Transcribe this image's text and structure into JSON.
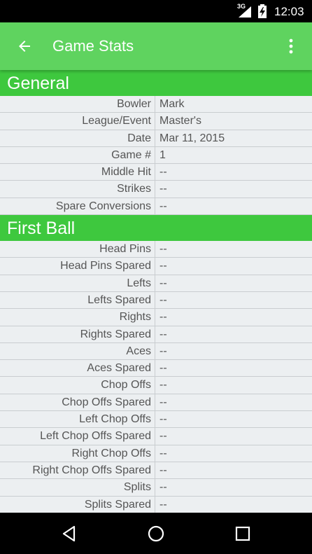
{
  "status_bar": {
    "network": "3G",
    "time": "12:03"
  },
  "app_bar": {
    "title": "Game Stats",
    "back_icon": "arrow-back-icon",
    "menu_icon": "more-vert-icon"
  },
  "colors": {
    "app_bar": "#5FD35F",
    "section_header": "#3EC83E",
    "background": "#ECEFF1"
  },
  "sections": [
    {
      "title": "General",
      "rows": [
        {
          "label": "Bowler",
          "value": "Mark"
        },
        {
          "label": "League/Event",
          "value": "Master's"
        },
        {
          "label": "Date",
          "value": "Mar 11, 2015"
        },
        {
          "label": "Game #",
          "value": "1"
        },
        {
          "label": "Middle Hit",
          "value": "--"
        },
        {
          "label": "Strikes",
          "value": "--"
        },
        {
          "label": "Spare Conversions",
          "value": "--"
        }
      ]
    },
    {
      "title": "First Ball",
      "rows": [
        {
          "label": "Head Pins",
          "value": "--"
        },
        {
          "label": "Head Pins Spared",
          "value": "--"
        },
        {
          "label": "Lefts",
          "value": "--"
        },
        {
          "label": "Lefts Spared",
          "value": "--"
        },
        {
          "label": "Rights",
          "value": "--"
        },
        {
          "label": "Rights Spared",
          "value": "--"
        },
        {
          "label": "Aces",
          "value": "--"
        },
        {
          "label": "Aces Spared",
          "value": "--"
        },
        {
          "label": "Chop Offs",
          "value": "--"
        },
        {
          "label": "Chop Offs Spared",
          "value": "--"
        },
        {
          "label": "Left Chop Offs",
          "value": "--"
        },
        {
          "label": "Left Chop Offs Spared",
          "value": "--"
        },
        {
          "label": "Right Chop Offs",
          "value": "--"
        },
        {
          "label": "Right Chop Offs Spared",
          "value": "--"
        },
        {
          "label": "Splits",
          "value": "--"
        },
        {
          "label": "Splits Spared",
          "value": "--"
        }
      ]
    }
  ],
  "nav_bar": {
    "back_icon": "nav-back-icon",
    "home_icon": "nav-home-icon",
    "recents_icon": "nav-recents-icon"
  }
}
